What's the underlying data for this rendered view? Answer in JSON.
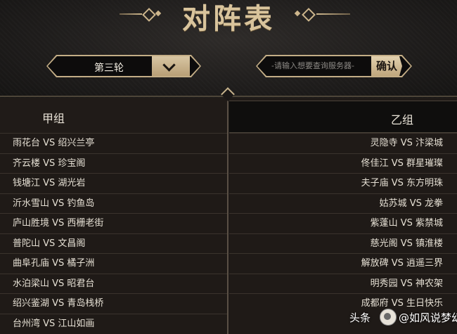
{
  "title": "对阵表",
  "round_select": {
    "selected": "第三轮"
  },
  "search": {
    "placeholder": "-请输入想要查询服务器-",
    "confirm_label": "确认"
  },
  "groups": [
    {
      "name": "甲组",
      "matches": [
        "雨花台 VS 绍兴兰亭",
        "齐云楼 VS 珍宝阁",
        "钱塘江 VS 湖光岩",
        "沂水雪山 VS 钓鱼岛",
        "庐山胜境 VS 西栅老街",
        "普陀山 VS 文昌阁",
        "曲阜孔庙 VS 橘子洲",
        "水泊梁山 VS 昭君台",
        "绍兴鉴湖 VS 青岛栈桥",
        "台州湾 VS 江山如画"
      ]
    },
    {
      "name": "乙组",
      "matches": [
        "灵隐寺 VS 汴梁城",
        "佟佳江 VS 群星璀璨",
        "夫子庙 VS 东方明珠",
        "姑苏城 VS 龙拳",
        "紫蓬山 VS 紫禁城",
        "慈光阁 VS 镇淮楼",
        "解放碑 VS 逍遥三界",
        "明秀园 VS 神农架",
        "成都府 VS 生日快乐"
      ]
    }
  ],
  "watermark": {
    "prefix": "头条",
    "author": "@如风说梦幻"
  }
}
